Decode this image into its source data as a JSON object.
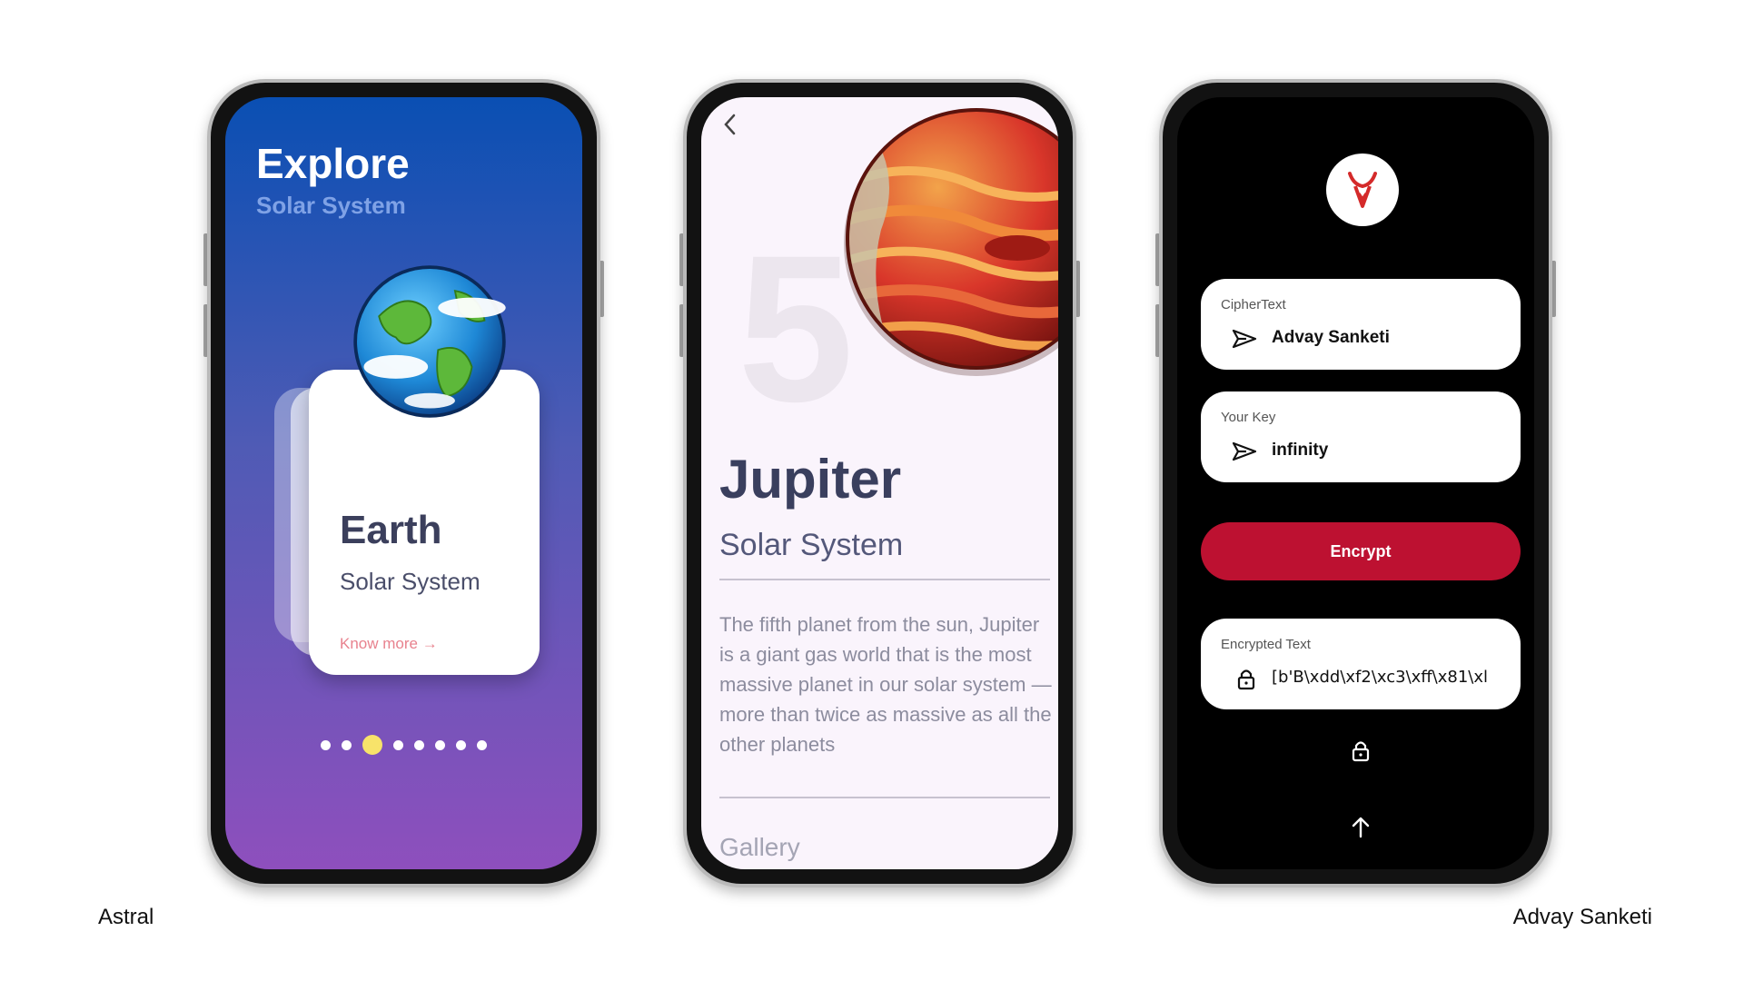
{
  "captions": {
    "left": "Astral",
    "right": "Advay Sanketi"
  },
  "astral": {
    "title": "Explore",
    "subtitle": "Solar System",
    "card": {
      "title": "Earth",
      "subtitle": "Solar System",
      "link": "Know more",
      "arrow": "→"
    },
    "pager": {
      "count": 8,
      "active_index": 2
    },
    "colors": {
      "gradient_top": "#0a4fb3",
      "gradient_bottom": "#8e4fbd",
      "active_dot": "#f7e36a"
    }
  },
  "jupiter": {
    "number": "5",
    "title": "Jupiter",
    "subtitle": "Solar System",
    "description": "The fifth planet from the sun, Jupiter is a giant gas world that is the most massive planet in our solar system — more than twice as massive as all the other planets",
    "gallery_label": "Gallery",
    "back_icon": "chevron-left-icon"
  },
  "cipher": {
    "logo_icon": "bull-head-logo",
    "ciphertext": {
      "label": "CipherText",
      "value": "Advay Sanketi",
      "icon": "send-icon"
    },
    "key": {
      "label": "Your Key",
      "value": "infinity",
      "icon": "send-icon"
    },
    "encrypt_label": "Encrypt",
    "encrypted": {
      "label": "Encrypted Text",
      "value": "[b'B\\xdd\\xf2\\xc3\\xff\\x81\\xl",
      "icon": "lock-icon"
    },
    "bottom_icons": [
      "unlock-icon",
      "arrow-up-icon"
    ],
    "colors": {
      "accent": "#bd1131"
    }
  }
}
